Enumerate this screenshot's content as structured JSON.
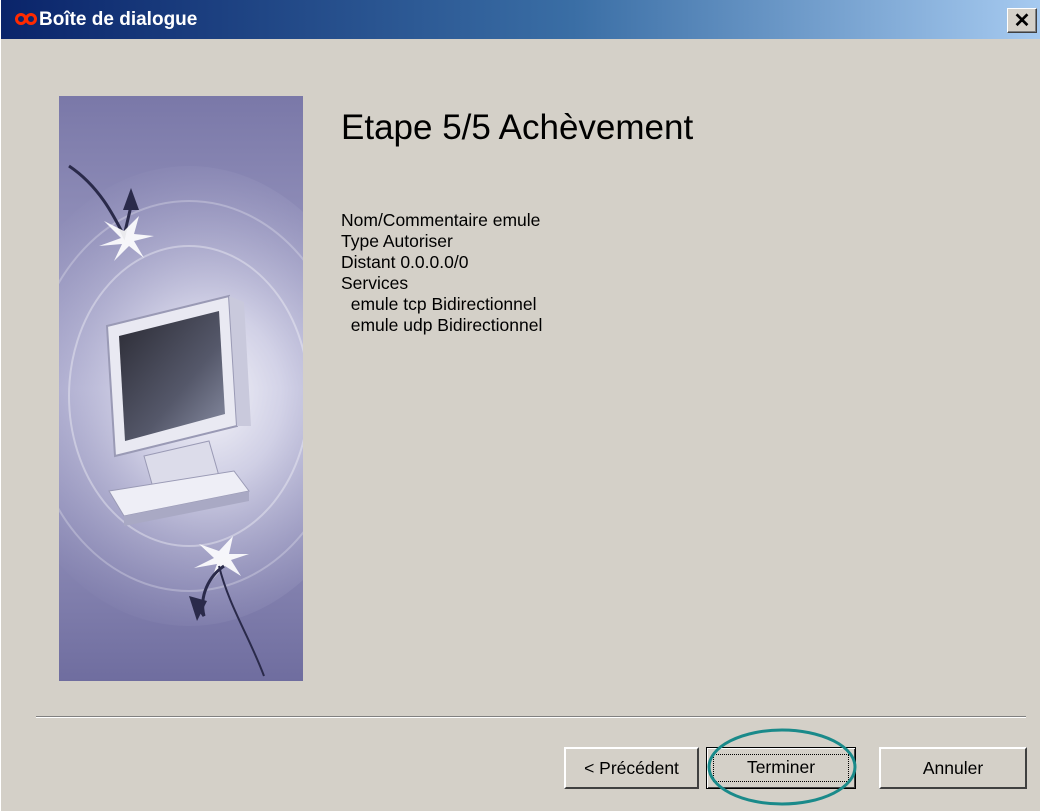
{
  "window": {
    "title": "Boîte de dialogue"
  },
  "wizard": {
    "heading": "Etape 5/5 Achèvement",
    "summary_lines": [
      "Nom/Commentaire emule",
      "Type Autoriser",
      "Distant 0.0.0.0/0",
      "Services",
      "  emule tcp Bidirectionnel",
      "  emule udp Bidirectionnel"
    ]
  },
  "buttons": {
    "previous": "< Précédent",
    "finish": "Terminer",
    "cancel": "Annuler"
  },
  "icons": {
    "app": "infinity-logo-icon",
    "close": "close-icon",
    "illustration": "monitor-illustration"
  },
  "colors": {
    "titlebar_start": "#0a246a",
    "titlebar_end": "#a6caf0",
    "dialog_bg": "#d4d0c8",
    "highlight_ring": "#1a8a8a"
  }
}
